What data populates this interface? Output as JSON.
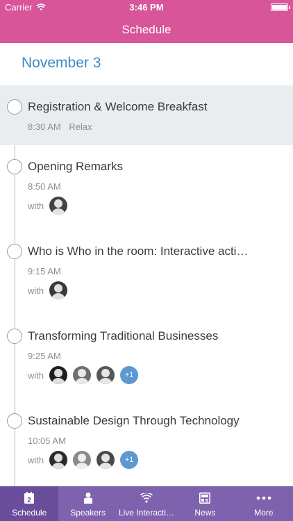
{
  "status_bar": {
    "carrier": "Carrier",
    "time": "3:46 PM"
  },
  "nav": {
    "title": "Schedule"
  },
  "date": "November 3",
  "sessions": [
    {
      "title": "Registration & Welcome Breakfast",
      "time": "8:30 AM",
      "tag": "Relax"
    },
    {
      "title": "Opening Remarks",
      "time": "8:50 AM",
      "with_label": "with"
    },
    {
      "title": "Who is Who in the room: Interactive acti…",
      "time": "9:15 AM",
      "with_label": "with"
    },
    {
      "title": "Transforming Traditional Businesses",
      "time": "9:25 AM",
      "with_label": "with",
      "more": "+1"
    },
    {
      "title": "Sustainable Design Through Technology",
      "time": "10:05 AM",
      "with_label": "with",
      "more": "+1"
    }
  ],
  "tabs": [
    {
      "label": "Schedule",
      "icon": "calendar-icon",
      "active": true
    },
    {
      "label": "Speakers",
      "icon": "person-icon"
    },
    {
      "label": "Live Interacti…",
      "icon": "wifi-icon"
    },
    {
      "label": "News",
      "icon": "newspaper-icon"
    },
    {
      "label": "More",
      "icon": "more-dots-icon"
    }
  ],
  "colors": {
    "header": "#d8559a",
    "date": "#3d8ac4",
    "tabbar": "#7f62ae",
    "tab_active": "#6b4e9b",
    "highlight_row": "#e9edf0",
    "badge": "#5e98d0"
  }
}
